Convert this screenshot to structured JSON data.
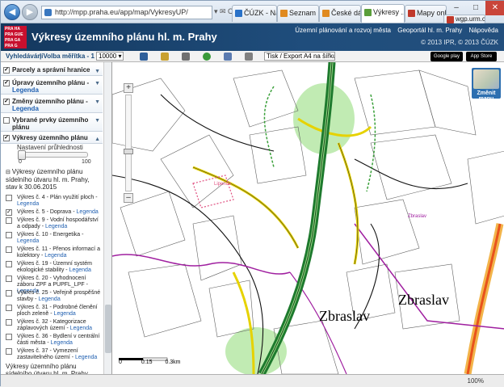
{
  "browser": {
    "address": "http://mpp.praha.eu/app/map/VykresyUP/",
    "address_tools": "▾ ✉ C",
    "tabs": [
      {
        "label": "ČÚZK - Náhl..."
      },
      {
        "label": "Seznam ne..."
      },
      {
        "label": "České dálni..."
      },
      {
        "label": "Výkresy ...",
        "active": true
      },
      {
        "label": "Mapy onli..."
      },
      {
        "label": "wgp.urm.cz"
      }
    ],
    "controls": {
      "min": "–",
      "max": "□",
      "close": "✕"
    },
    "icons": "⌂ ★ ⚙"
  },
  "header": {
    "logo_text": [
      "PRA HA",
      "PRA GUE",
      "PRA GA",
      "PRA G"
    ],
    "title": "Výkresy územního plánu hl. m. Prahy",
    "links": [
      "Územní plánování a rozvoj města",
      "Geoportál hl. m. Prahy",
      "Nápověda"
    ],
    "copyright": "© 2013 IPR, © 2013 ČÚZK"
  },
  "toolbar": {
    "search_label": "Vyhledávání",
    "scale_label": "| Volba měřítka - 1 :",
    "scale_value": "10000 ▾",
    "print_value": "Tisk / Export A4 na šířku ▾",
    "google_play": "Google play",
    "app_store": "App Store"
  },
  "sidebar": {
    "layers": [
      {
        "label": "Parcely a správní hranice",
        "checked": true
      },
      {
        "label": "Úpravy územního plánu -",
        "legend": "Legenda",
        "checked": true
      },
      {
        "label": "Změny územního plánu -",
        "legend": "Legenda",
        "checked": true
      },
      {
        "label": "Vybrané prvky územního plánu",
        "checked": false
      },
      {
        "label": "Výkresy územního plánu",
        "checked": true
      }
    ],
    "opacity_label": "Nastavení průhlednosti",
    "opacity_min": "0",
    "opacity_max": "100",
    "opacity_value": 0,
    "sub_title": "Výkresy územního plánu sídelního útvaru hl. m. Prahy, stav k 30.06.2015",
    "sub_items": [
      {
        "label": "Výkres č. 4 - Plán využití ploch -",
        "legend": "Legenda",
        "checked": false
      },
      {
        "label": "Výkres č. 5 - Doprava -",
        "legend": "Legenda",
        "checked": true
      },
      {
        "label": "Výkres č. 9 - Vodní hospodářství a odpady -",
        "legend": "Legenda",
        "checked": false
      },
      {
        "label": "Výkres č. 10 - Energetika -",
        "legend": "Legenda",
        "checked": false
      },
      {
        "label": "Výkres č. 11 - Přenos informací a kolektory -",
        "legend": "Legenda",
        "checked": false
      },
      {
        "label": "Výkres č. 19 - Územní systém ekologické stability -",
        "legend": "Legenda",
        "checked": false
      },
      {
        "label": "Výkres č. 20 - Vyhodnocení záboru ZPF a PUPFL_LPF -",
        "legend": "Legenda",
        "checked": false
      },
      {
        "label": "Výkres č. 25 - Veřejně prospěšné stavby -",
        "legend": "Legenda",
        "checked": false
      },
      {
        "label": "Výkres č. 31 - Podrobné členění ploch zeleně -",
        "legend": "Legenda",
        "checked": false
      },
      {
        "label": "Výkres č. 32 - Kategorizace záplavových území -",
        "legend": "Legenda",
        "checked": false
      },
      {
        "label": "Výkres č. 36 - Bydlení v centrální části města -",
        "legend": "Legenda",
        "checked": false
      },
      {
        "label": "Výkres č. 37 - Vymezení zastavitelného území -",
        "legend": "Legenda",
        "checked": false
      }
    ],
    "bottom_title": "Výkresy územního plánu sídelního útvaru hl. m. Prahy,"
  },
  "map": {
    "change_map_label": "Změnit mapu",
    "zoom_in": "+",
    "zoom_out": "–",
    "place_names": [
      {
        "text": "Zbraslav",
        "size": 18
      },
      {
        "text": "Zbraslav",
        "size": 18
      }
    ],
    "small_label": "Lipence",
    "small_label2": "Zbraslav",
    "scale_labels": [
      "0",
      "0.15",
      "0.3km"
    ]
  },
  "status": {
    "zoom": "100%"
  }
}
